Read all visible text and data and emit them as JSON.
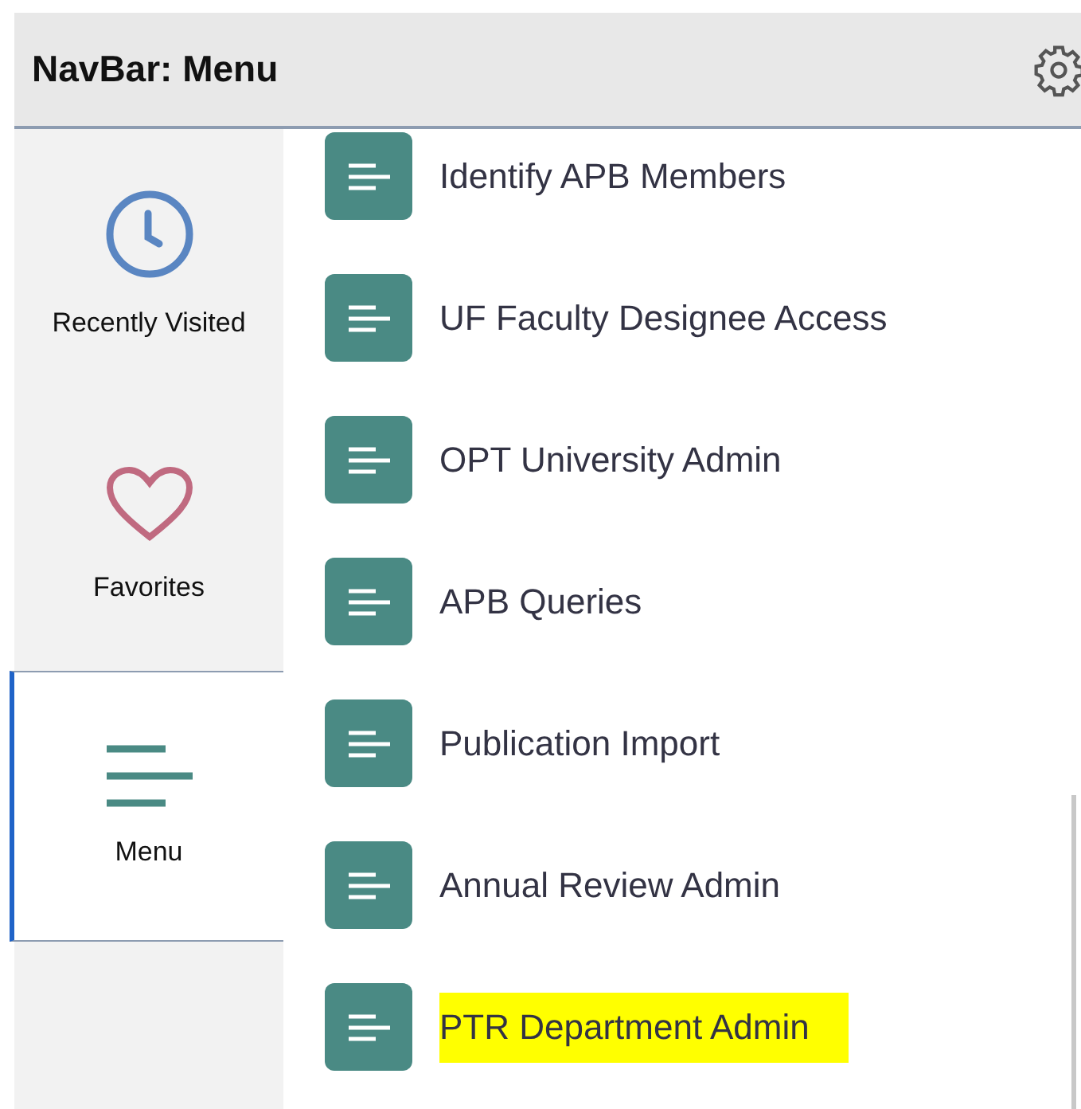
{
  "header": {
    "title": "NavBar: Menu"
  },
  "sidebar": {
    "items": [
      {
        "label": "Recently Visited",
        "kind": "clock",
        "selected": false
      },
      {
        "label": "Favorites",
        "kind": "heart",
        "selected": false
      },
      {
        "label": "Menu",
        "kind": "menu",
        "selected": true
      }
    ]
  },
  "menu_items": [
    {
      "label": "Identify APB Members",
      "highlighted": false
    },
    {
      "label": "UF Faculty Designee Access",
      "highlighted": false
    },
    {
      "label": "OPT University Admin",
      "highlighted": false
    },
    {
      "label": "APB Queries",
      "highlighted": false
    },
    {
      "label": "Publication Import",
      "highlighted": false
    },
    {
      "label": "Annual Review Admin",
      "highlighted": false
    },
    {
      "label": "PTR Department Admin",
      "highlighted": true
    }
  ]
}
